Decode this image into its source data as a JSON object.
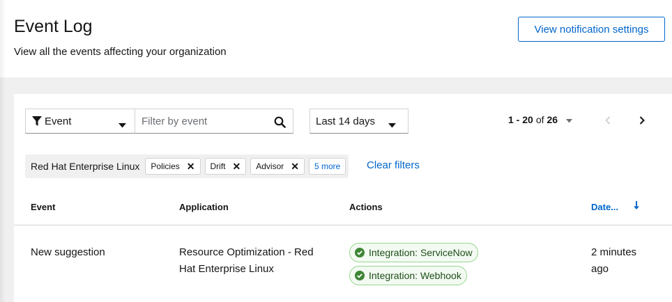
{
  "header": {
    "title": "Event Log",
    "subtitle": "View all the events affecting your organization",
    "notification_button": "View notification settings"
  },
  "toolbar": {
    "filter_type": "Event",
    "search_placeholder": "Filter by event",
    "date_range": "Last 14 days",
    "pagination": {
      "range": "1 - 20",
      "of": "of",
      "total": "26"
    }
  },
  "filters": {
    "category": "Red Hat Enterprise Linux",
    "chips": [
      "Policies",
      "Drift",
      "Advisor"
    ],
    "more_label": "5 more",
    "clear_label": "Clear filters"
  },
  "table": {
    "columns": {
      "event": "Event",
      "application": "Application",
      "actions": "Actions",
      "date": "Date..."
    },
    "rows": [
      {
        "event": "New suggestion",
        "application_line1": "Resource Optimization - Red",
        "application_line2": "Hat Enterprise Linux",
        "actions": [
          "Integration: ServiceNow",
          "Integration: Webhook"
        ],
        "date_line1": "2 minutes",
        "date_line2": "ago"
      }
    ]
  },
  "colors": {
    "link": "#0066cc",
    "success_border": "#95d58e",
    "success_icon": "#3e8635"
  }
}
